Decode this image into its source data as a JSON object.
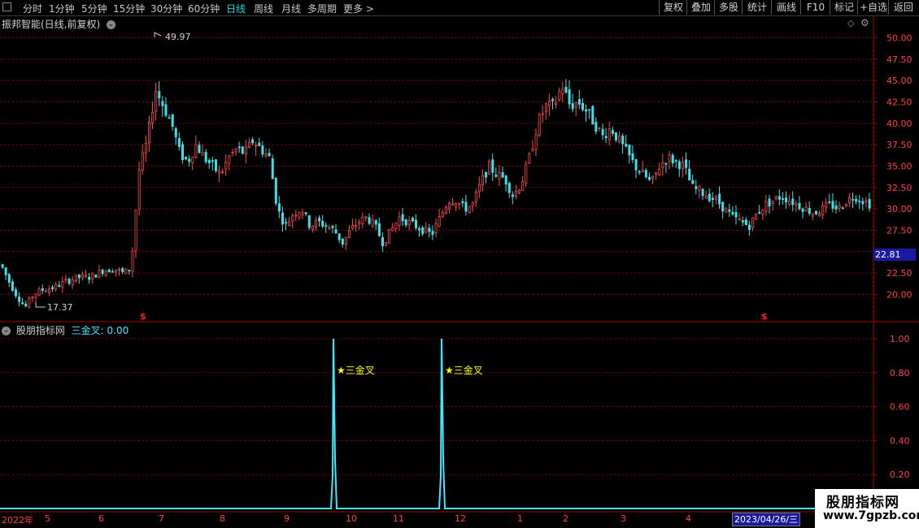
{
  "toolbar": {
    "periods": [
      "分时",
      "1分钟",
      "5分钟",
      "15分钟",
      "30分钟",
      "60分钟",
      "日线",
      "周线",
      "月线",
      "多周期",
      "更多 >"
    ],
    "selected_period": "日线",
    "buttons": [
      "复权",
      "叠加",
      "多股",
      "统计",
      "画线",
      "F10",
      "标记",
      "+自选",
      "返回"
    ]
  },
  "main_chart": {
    "title": "振邦智能(日线,前复权)",
    "current_price_label": "22.81",
    "high_marker": "49.97",
    "low_marker": "17.37"
  },
  "indicator": {
    "name": "股朋指标网",
    "formula_label": "三金叉:",
    "formula_value": "0.00",
    "signal_label": "三金叉"
  },
  "date_axis": {
    "labels": [
      "2022年",
      "5",
      "6",
      "7",
      "8",
      "9",
      "10",
      "11",
      "12",
      "1",
      "2",
      "3",
      "4"
    ],
    "highlight": "2023/04/26/三"
  },
  "watermark": {
    "line1": "股朋指标网",
    "line2": "www.7gpzb.com"
  },
  "colors": {
    "up": "#ff4848",
    "down": "#40e0e8",
    "grid": "#8b0000",
    "signal_line": "#40e8ff",
    "star": "#ffff00"
  },
  "chart_data": [
    {
      "type": "candlestick",
      "title": "振邦智能(日线,前复权)",
      "y_ticks": [
        "50.00",
        "47.50",
        "45.00",
        "42.50",
        "40.00",
        "37.50",
        "35.00",
        "32.50",
        "30.00",
        "27.50",
        "25.00",
        "22.50",
        "20.00"
      ],
      "ylim": [
        17.0,
        51.0
      ],
      "x_months": [
        "2022年",
        "5",
        "6",
        "7",
        "8",
        "9",
        "10",
        "11",
        "12",
        "1",
        "2",
        "3",
        "4"
      ],
      "close_trend": [
        [
          0,
          23.5
        ],
        [
          10,
          21.5
        ],
        [
          20,
          19.8
        ],
        [
          30,
          18.5
        ],
        [
          40,
          20.0
        ],
        [
          50,
          20.5
        ],
        [
          65,
          20.8
        ],
        [
          80,
          21.5
        ],
        [
          95,
          22.0
        ],
        [
          110,
          22.0
        ],
        [
          125,
          22.8
        ],
        [
          140,
          23.0
        ],
        [
          150,
          22.5
        ],
        [
          160,
          23.0
        ],
        [
          170,
          34.5
        ],
        [
          180,
          38.0
        ],
        [
          190,
          44.0
        ],
        [
          200,
          42.0
        ],
        [
          210,
          40.0
        ],
        [
          220,
          36.5
        ],
        [
          230,
          35.5
        ],
        [
          240,
          37.5
        ],
        [
          250,
          36.0
        ],
        [
          260,
          35.0
        ],
        [
          270,
          34.0
        ],
        [
          280,
          36.0
        ],
        [
          290,
          37.0
        ],
        [
          300,
          36.5
        ],
        [
          310,
          38.0
        ],
        [
          320,
          37.0
        ],
        [
          330,
          36.0
        ],
        [
          340,
          30.0
        ],
        [
          350,
          28.0
        ],
        [
          360,
          29.5
        ],
        [
          370,
          30.0
        ],
        [
          380,
          28.0
        ],
        [
          390,
          28.5
        ],
        [
          400,
          28.0
        ],
        [
          410,
          27.5
        ],
        [
          420,
          26.0
        ],
        [
          430,
          27.5
        ],
        [
          440,
          28.5
        ],
        [
          450,
          29.0
        ],
        [
          460,
          28.0
        ],
        [
          470,
          26.0
        ],
        [
          480,
          27.5
        ],
        [
          490,
          29.0
        ],
        [
          500,
          28.5
        ],
        [
          510,
          28.0
        ],
        [
          520,
          27.5
        ],
        [
          530,
          27.0
        ],
        [
          540,
          29.0
        ],
        [
          550,
          31.0
        ],
        [
          560,
          31.0
        ],
        [
          570,
          30.0
        ],
        [
          580,
          30.5
        ],
        [
          590,
          33.0
        ],
        [
          600,
          35.0
        ],
        [
          610,
          34.0
        ],
        [
          620,
          33.5
        ],
        [
          630,
          31.5
        ],
        [
          640,
          33.0
        ],
        [
          650,
          36.0
        ],
        [
          660,
          40.0
        ],
        [
          670,
          42.0
        ],
        [
          680,
          42.0
        ],
        [
          690,
          44.5
        ],
        [
          700,
          42.0
        ],
        [
          710,
          42.5
        ],
        [
          720,
          41.5
        ],
        [
          730,
          40.0
        ],
        [
          740,
          38.5
        ],
        [
          750,
          39.5
        ],
        [
          760,
          38.0
        ],
        [
          770,
          36.5
        ],
        [
          780,
          35.0
        ],
        [
          790,
          34.0
        ],
        [
          800,
          33.0
        ],
        [
          810,
          35.0
        ],
        [
          820,
          36.0
        ],
        [
          830,
          35.5
        ],
        [
          840,
          35.0
        ],
        [
          850,
          32.5
        ],
        [
          860,
          32.0
        ],
        [
          870,
          31.5
        ],
        [
          880,
          31.0
        ],
        [
          890,
          30.0
        ],
        [
          900,
          29.0
        ],
        [
          910,
          28.5
        ],
        [
          920,
          28.0
        ],
        [
          930,
          29.5
        ],
        [
          940,
          30.5
        ],
        [
          950,
          31.0
        ],
        [
          960,
          31.5
        ],
        [
          970,
          31.0
        ],
        [
          980,
          30.5
        ],
        [
          990,
          30.0
        ],
        [
          1000,
          29.5
        ],
        [
          1010,
          30.0
        ],
        [
          1020,
          30.5
        ],
        [
          1030,
          30.0
        ],
        [
          1040,
          31.0
        ],
        [
          1050,
          31.5
        ],
        [
          1060,
          31.0
        ],
        [
          1070,
          30.5
        ]
      ]
    },
    {
      "type": "line",
      "title": "股朋指标网",
      "y_ticks": [
        "1.00",
        "0.80",
        "0.60",
        "0.40",
        "0.20"
      ],
      "ylim": [
        0,
        1.0
      ],
      "series": [
        {
          "name": "三金叉",
          "values": [
            0,
            1.0,
            0,
            1.0,
            0
          ]
        }
      ]
    }
  ]
}
